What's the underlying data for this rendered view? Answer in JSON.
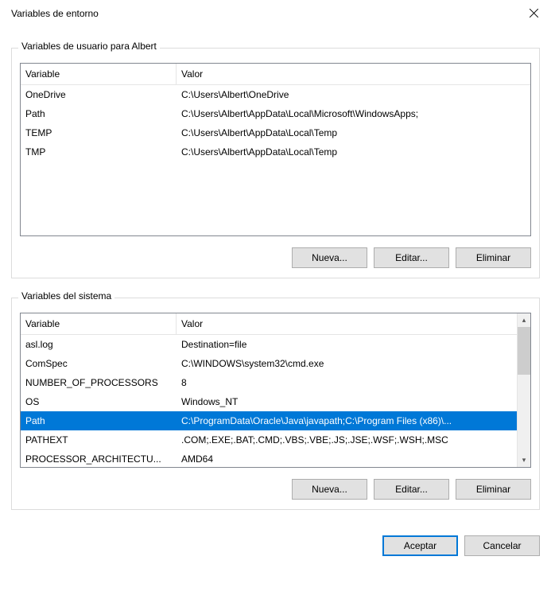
{
  "title": "Variables de entorno",
  "user_group_title": "Variables de usuario para Albert",
  "sys_group_title": "Variables del sistema",
  "headers": {
    "variable": "Variable",
    "value": "Valor"
  },
  "user_vars": [
    {
      "name": "OneDrive",
      "value": "C:\\Users\\Albert\\OneDrive"
    },
    {
      "name": "Path",
      "value": "C:\\Users\\Albert\\AppData\\Local\\Microsoft\\WindowsApps;"
    },
    {
      "name": "TEMP",
      "value": "C:\\Users\\Albert\\AppData\\Local\\Temp"
    },
    {
      "name": "TMP",
      "value": "C:\\Users\\Albert\\AppData\\Local\\Temp"
    }
  ],
  "sys_vars": [
    {
      "name": "asl.log",
      "value": "Destination=file",
      "selected": false
    },
    {
      "name": "ComSpec",
      "value": "C:\\WINDOWS\\system32\\cmd.exe",
      "selected": false
    },
    {
      "name": "NUMBER_OF_PROCESSORS",
      "value": "8",
      "selected": false
    },
    {
      "name": "OS",
      "value": "Windows_NT",
      "selected": false
    },
    {
      "name": "Path",
      "value": "C:\\ProgramData\\Oracle\\Java\\javapath;C:\\Program Files (x86)\\...",
      "selected": true
    },
    {
      "name": "PATHEXT",
      "value": ".COM;.EXE;.BAT;.CMD;.VBS;.VBE;.JS;.JSE;.WSF;.WSH;.MSC",
      "selected": false
    },
    {
      "name": "PROCESSOR_ARCHITECTU...",
      "value": "AMD64",
      "selected": false
    }
  ],
  "buttons": {
    "new": "Nueva...",
    "edit": "Editar...",
    "delete": "Eliminar",
    "ok": "Aceptar",
    "cancel": "Cancelar"
  }
}
